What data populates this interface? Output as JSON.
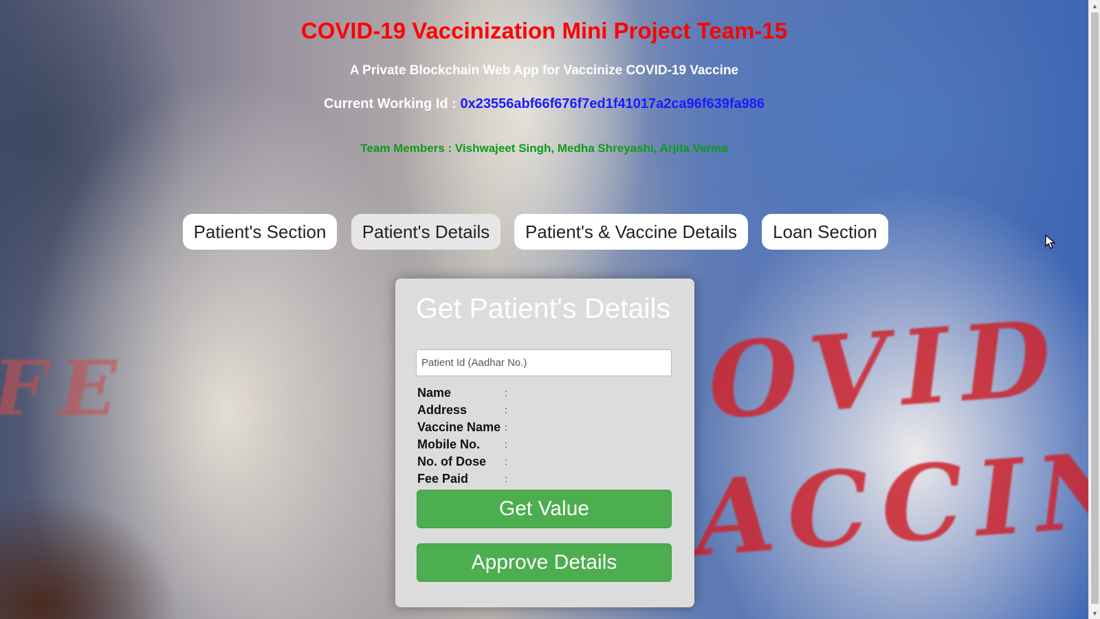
{
  "header": {
    "title": "COVID-19 Vaccinization Mini Project Team-15",
    "subtitle": "A Private Blockchain Web App for Vaccinize COVID-19 Vaccine",
    "working_id_label": "Current Working Id : ",
    "working_id_value": "0x23556abf66f676f7ed1f41017a2ca96f639fa986",
    "team": "Team Members : Vishwajeet Singh, Medha Shreyashi, Arjita Verma"
  },
  "nav": {
    "items": [
      {
        "label": "Patient's Section"
      },
      {
        "label": "Patient's Details",
        "active": true
      },
      {
        "label": "Patient's & Vaccine Details"
      },
      {
        "label": "Loan Section"
      }
    ]
  },
  "card": {
    "title": "Get Patient's Details",
    "input_placeholder": "Patient Id (Aadhar No.)",
    "fields": [
      {
        "label": "Name",
        "value": ""
      },
      {
        "label": "Address",
        "value": ""
      },
      {
        "label": "Vaccine Name",
        "value": ""
      },
      {
        "label": "Mobile No.",
        "value": ""
      },
      {
        "label": "No. of Dose",
        "value": ""
      },
      {
        "label": "Fee Paid",
        "value": ""
      }
    ],
    "colon": ":",
    "get_value_label": "Get Value",
    "approve_label": "Approve Details"
  },
  "background_words": {
    "covid": "OVID",
    "vaccine": "ACCINE",
    "left_fragment": "FE"
  },
  "colors": {
    "title": "#ff0000",
    "address": "#1a1aff",
    "team": "#0f9a1a",
    "button_green": "#4cae4f"
  },
  "icons": {
    "scroll_up": "▲",
    "scroll_down": "▼"
  }
}
